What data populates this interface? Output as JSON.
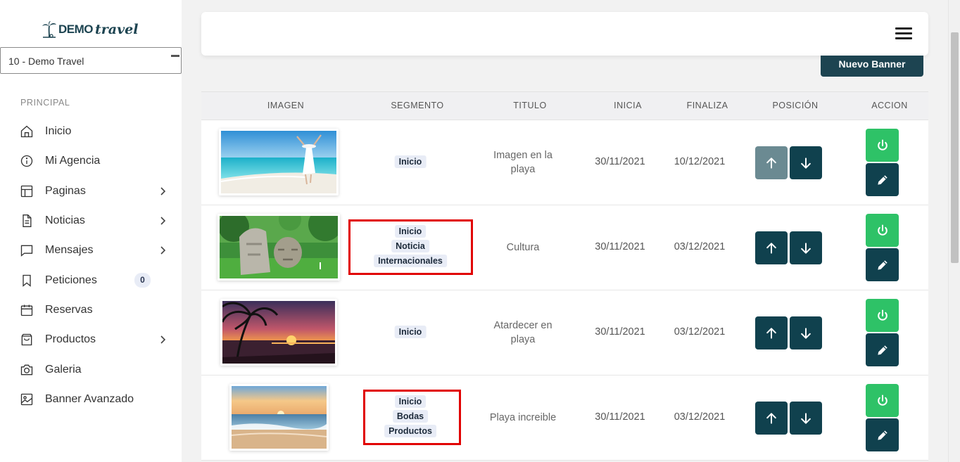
{
  "logo": {
    "demo": "DEMO",
    "travel": "travel"
  },
  "agency_select": {
    "value": "10 - Demo Travel"
  },
  "sidebar": {
    "section_label": "PRINCIPAL",
    "items": [
      {
        "label": "Inicio",
        "icon": "home-icon"
      },
      {
        "label": "Mi Agencia",
        "icon": "info-icon"
      },
      {
        "label": "Paginas",
        "icon": "layout-icon",
        "chevron": true
      },
      {
        "label": "Noticias",
        "icon": "document-icon",
        "chevron": true
      },
      {
        "label": "Mensajes",
        "icon": "message-icon",
        "chevron": true
      },
      {
        "label": "Peticiones",
        "icon": "bookmark-icon",
        "badge": "0"
      },
      {
        "label": "Reservas",
        "icon": "calendar-icon"
      },
      {
        "label": "Productos",
        "icon": "shopping-bag-icon",
        "chevron": true
      },
      {
        "label": "Galeria",
        "icon": "camera-icon"
      },
      {
        "label": "Banner Avanzado",
        "icon": "image-icon"
      }
    ]
  },
  "toolbar": {
    "new_banner_label": "Nuevo Banner"
  },
  "table": {
    "headers": [
      "IMAGEN",
      "SEGMENTO",
      "TITULO",
      "INICIA",
      "FINALIZA",
      "POSICIÓN",
      "ACCION"
    ],
    "rows": [
      {
        "image": "beach-woman-photo",
        "segments": [
          "Inicio"
        ],
        "title": "Imagen en la playa",
        "start": "30/11/2021",
        "end": "10/12/2021",
        "up_disabled": true,
        "highlighted": false
      },
      {
        "image": "olmec-heads-photo",
        "segments": [
          "Inicio",
          "Noticia",
          "Internacionales"
        ],
        "title": "Cultura",
        "start": "30/11/2021",
        "end": "03/12/2021",
        "up_disabled": false,
        "highlighted": true
      },
      {
        "image": "sunset-palm-photo",
        "segments": [
          "Inicio"
        ],
        "title": "Atardecer en playa",
        "start": "30/11/2021",
        "end": "03/12/2021",
        "up_disabled": false,
        "highlighted": false
      },
      {
        "image": "beach-sunrise-photo",
        "segments": [
          "Inicio",
          "Bodas",
          "Productos"
        ],
        "title": "Playa increible",
        "start": "30/11/2021",
        "end": "03/12/2021",
        "up_disabled": false,
        "highlighted": true
      }
    ]
  },
  "colors": {
    "primary": "#10414e",
    "success": "#2ec267",
    "highlight": "#e10000"
  }
}
